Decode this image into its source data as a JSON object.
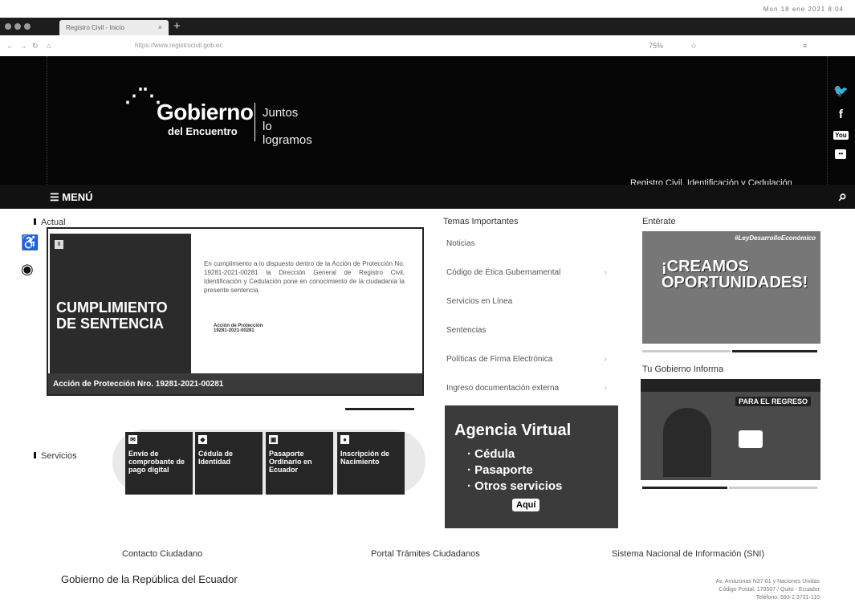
{
  "browser": {
    "system_bar": "Mon 18 ene 2021 8:04",
    "tab_title": "Registro Civil - Inicio",
    "url": "https://www.registrocivil.gob.ec",
    "zoom": "75%"
  },
  "header": {
    "logo_main": "Gobierno",
    "logo_sub": "del Encuentro",
    "slogan_line1": "Juntos",
    "slogan_line2": "lo logramos",
    "agency": "Registro Civil, Identificación y Cedulación",
    "menu": "MENÚ"
  },
  "social": {
    "twitter": "twitter-icon",
    "facebook": "facebook-icon",
    "youtube": "youtube-icon",
    "flickr": "flickr-icon"
  },
  "actual": {
    "label": "Actual",
    "headline_line1": "CUMPLIMIENTO",
    "headline_line2": "DE SENTENCIA",
    "text": "En cumplimiento a lo dispuesto dentro de la Acción de Protección No. 19281-2021-00281 la Dirección General de Registro Civil, Identificación y Cedulación pone en conocimiento de la ciudadanía la presente sentencia.",
    "doc_title": "Acción de Protección",
    "doc_number": "19281-2021-00281",
    "caption": "Acción de Protección Nro. 19281-2021-00281"
  },
  "servicios": {
    "label": "Servicios",
    "cards": [
      {
        "label": "Envío de comprobante de pago digital"
      },
      {
        "label": "Cédula de Identidad"
      },
      {
        "label": "Pasaporte Ordinario en Ecuador"
      },
      {
        "label": "Inscripción de Nacimiento"
      }
    ]
  },
  "temas": {
    "label": "Temas Importantes",
    "items": [
      {
        "label": "Noticias"
      },
      {
        "label": "Código de Ética Gubernamental"
      },
      {
        "label": "Servicios en Línea"
      },
      {
        "label": "Sentencias"
      },
      {
        "label": "Políticas de Firma Electrónica"
      },
      {
        "label": "Ingreso documentación externa"
      }
    ]
  },
  "agencia": {
    "title": "Agencia Virtual",
    "items": [
      "Cédula",
      "Pasaporte",
      "Otros servicios"
    ],
    "cta": "Aquí"
  },
  "enterate": {
    "label": "Entérate",
    "hashtag": "#LeyDesarrolloEconómico",
    "headline_line1": "¡CREAMOS",
    "headline_line2": "OPORTUNIDADES!"
  },
  "informa": {
    "label": "Tu Gobierno Informa",
    "caption": "PARA EL REGRESO"
  },
  "footer": {
    "link1": "Contacto Ciudadano",
    "link2": "Portal Trámites Ciudadanos",
    "link3": "Sistema Nacional de Información (SNI)",
    "gov": "Gobierno de la República del Ecuador",
    "addr1": "Av. Amazonas N37-61 y Naciones Unidas",
    "addr2": "Código Postal: 170507 / Quito - Ecuador",
    "addr3": "Teléfono: 593-2 3731-110"
  }
}
